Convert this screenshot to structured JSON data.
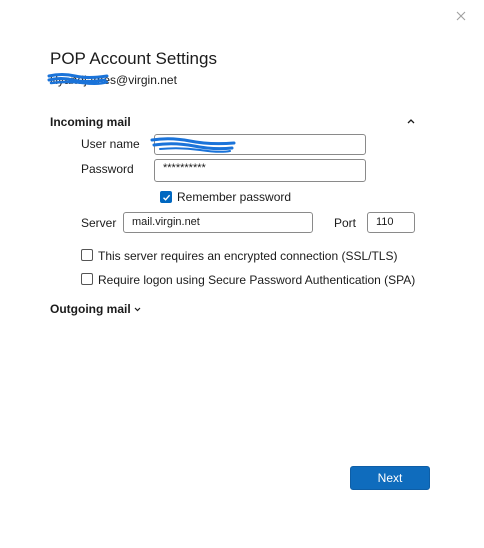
{
  "dialog": {
    "title": "POP Account Settings",
    "account_email": "lilyandjames@virgin.net"
  },
  "incoming": {
    "header": "Incoming mail",
    "username_label": "User name",
    "username_value": "",
    "password_label": "Password",
    "password_value": "**********",
    "remember_password_label": "Remember password",
    "remember_password_checked": true,
    "server_label": "Server",
    "server_value": "mail.virgin.net",
    "port_label": "Port",
    "port_value": "110",
    "ssl_label": "This server requires an encrypted connection (SSL/TLS)",
    "ssl_checked": false,
    "spa_label": "Require logon using Secure Password Authentication (SPA)",
    "spa_checked": false
  },
  "outgoing": {
    "header": "Outgoing mail"
  },
  "footer": {
    "next_label": "Next"
  },
  "colors": {
    "accent": "#0f6cbd",
    "redaction": "#1a73d9"
  },
  "icons": {
    "close": "close-icon",
    "collapse": "chevron-up-icon",
    "expand": "chevron-down-icon",
    "check": "checkmark-icon"
  }
}
